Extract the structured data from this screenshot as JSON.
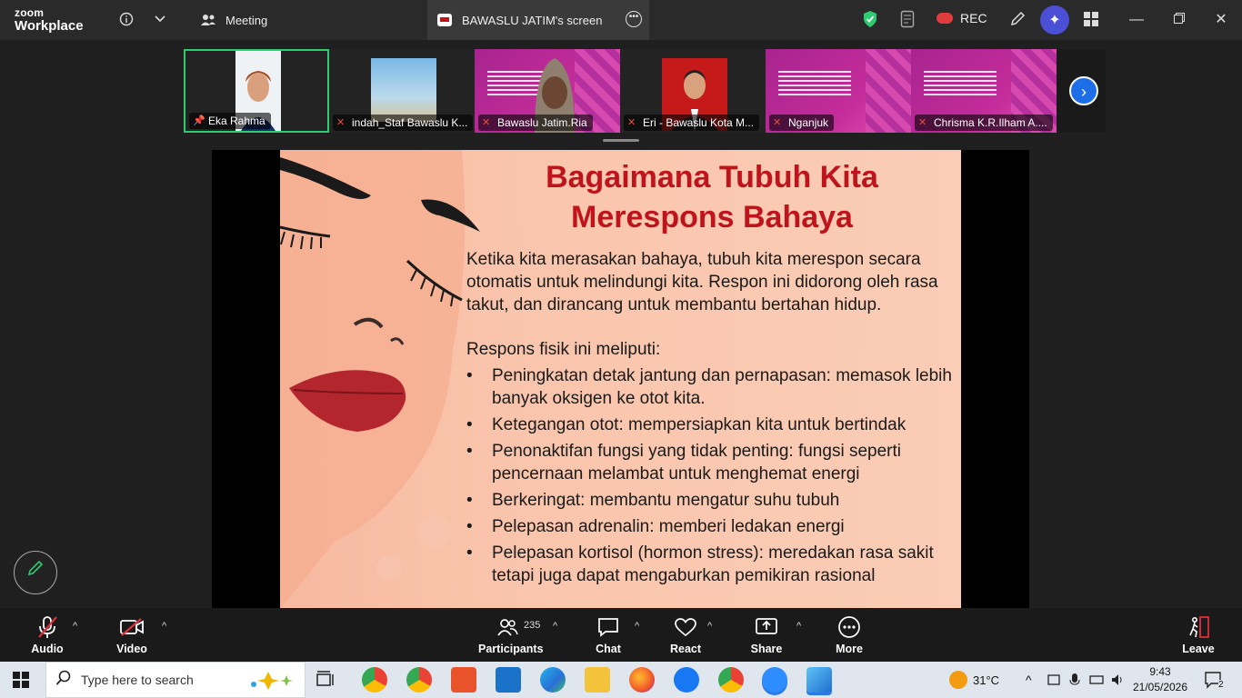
{
  "app": {
    "logo_line1": "zoom",
    "logo_line2": "Workplace"
  },
  "titlebar": {
    "tabs": [
      {
        "label": "Meeting"
      },
      {
        "label": "BAWASLU JATIM's screen"
      }
    ],
    "rec_label": "REC",
    "colors": {
      "shield": "#2ecc71",
      "rec": "#e03c3c",
      "ai": "#4a4fd6"
    }
  },
  "participants_strip": {
    "thumbnails": [
      {
        "name": "Eka Rahma",
        "pinned": true,
        "muted": false
      },
      {
        "name": "indah_Staf Bawaslu K...",
        "muted": true
      },
      {
        "name": "Bawaslu Jatim.Ria",
        "muted": true
      },
      {
        "name": "Eri - Bawaslu Kota M...",
        "muted": true
      },
      {
        "name": "Nganjuk",
        "muted": true
      },
      {
        "name": "Chrisma K.R.Ilham A....",
        "muted": true
      }
    ]
  },
  "slide": {
    "title_line1": "Bagaimana Tubuh Kita",
    "title_line2": "Merespons Bahaya",
    "intro": "Ketika kita merasakan bahaya, tubuh kita merespon secara otomatis untuk melindungi kita. Respon ini didorong oleh rasa takut, dan dirancang untuk membantu bertahan hidup.",
    "list_heading": "Respons fisik ini meliputi:",
    "bullets": [
      "Peningkatan detak jantung dan pernapasan: memasok lebih banyak oksigen ke otot kita.",
      "Ketegangan otot: mempersiapkan kita untuk bertindak",
      "Penonaktifan fungsi yang tidak penting: fungsi seperti pencernaan melambat untuk menghemat energi",
      "Berkeringat: membantu mengatur suhu tubuh",
      "Pelepasan adrenalin: memberi ledakan energi",
      "Pelepasan kortisol (hormon stress): meredakan rasa sakit tetapi juga dapat mengaburkan pemikiran rasional"
    ],
    "colors": {
      "title": "#c0141c",
      "background": "#f9c4ab"
    }
  },
  "toolbar": {
    "audio": "Audio",
    "video": "Video",
    "participants": "Participants",
    "participants_count": "235",
    "chat": "Chat",
    "react": "React",
    "share": "Share",
    "more": "More",
    "leave": "Leave"
  },
  "taskbar": {
    "search_placeholder": "Type here to search",
    "weather": "31°C",
    "time": "9:43",
    "date": "21/05/2026",
    "notifications": "2"
  }
}
